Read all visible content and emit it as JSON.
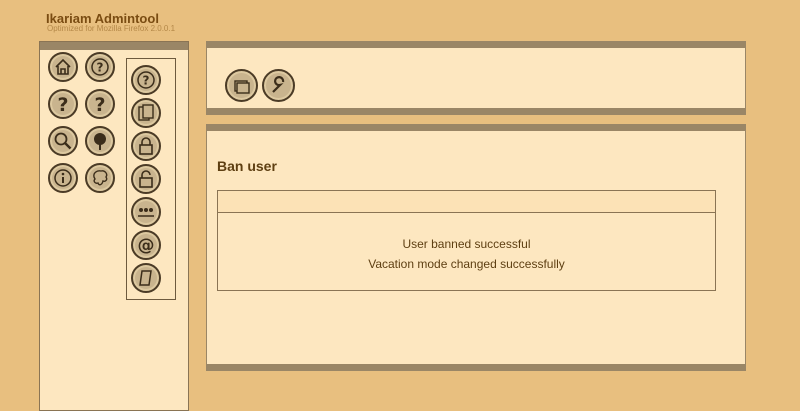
{
  "header": {
    "title": "Ikariam Admintool",
    "subtitle": "Optimized for Mozilla Firefox 2.0.0.1"
  },
  "sidebar": {
    "buttons": [
      {
        "name": "home-icon"
      },
      {
        "name": "help-icon"
      },
      {
        "name": "question-icon"
      },
      {
        "name": "question-icon-2"
      },
      {
        "name": "search-icon"
      },
      {
        "name": "pin-icon"
      },
      {
        "name": "info-icon"
      },
      {
        "name": "map-icon"
      }
    ],
    "subpanel_buttons": [
      {
        "name": "help-icon"
      },
      {
        "name": "documents-icon"
      },
      {
        "name": "lock-icon"
      },
      {
        "name": "unlock-icon"
      },
      {
        "name": "users-icon"
      },
      {
        "name": "at-icon"
      },
      {
        "name": "note-icon"
      }
    ]
  },
  "toolbar": {
    "buttons": [
      {
        "name": "folders-icon"
      },
      {
        "name": "wrench-icon"
      }
    ]
  },
  "main": {
    "heading": "Ban user",
    "messages": [
      "User banned successful",
      "Vacation mode changed successfully"
    ]
  },
  "colors": {
    "background": "#e8bf7f",
    "panel": "#fde7c0",
    "bar": "#9a8666",
    "text": "#5e3f12"
  }
}
